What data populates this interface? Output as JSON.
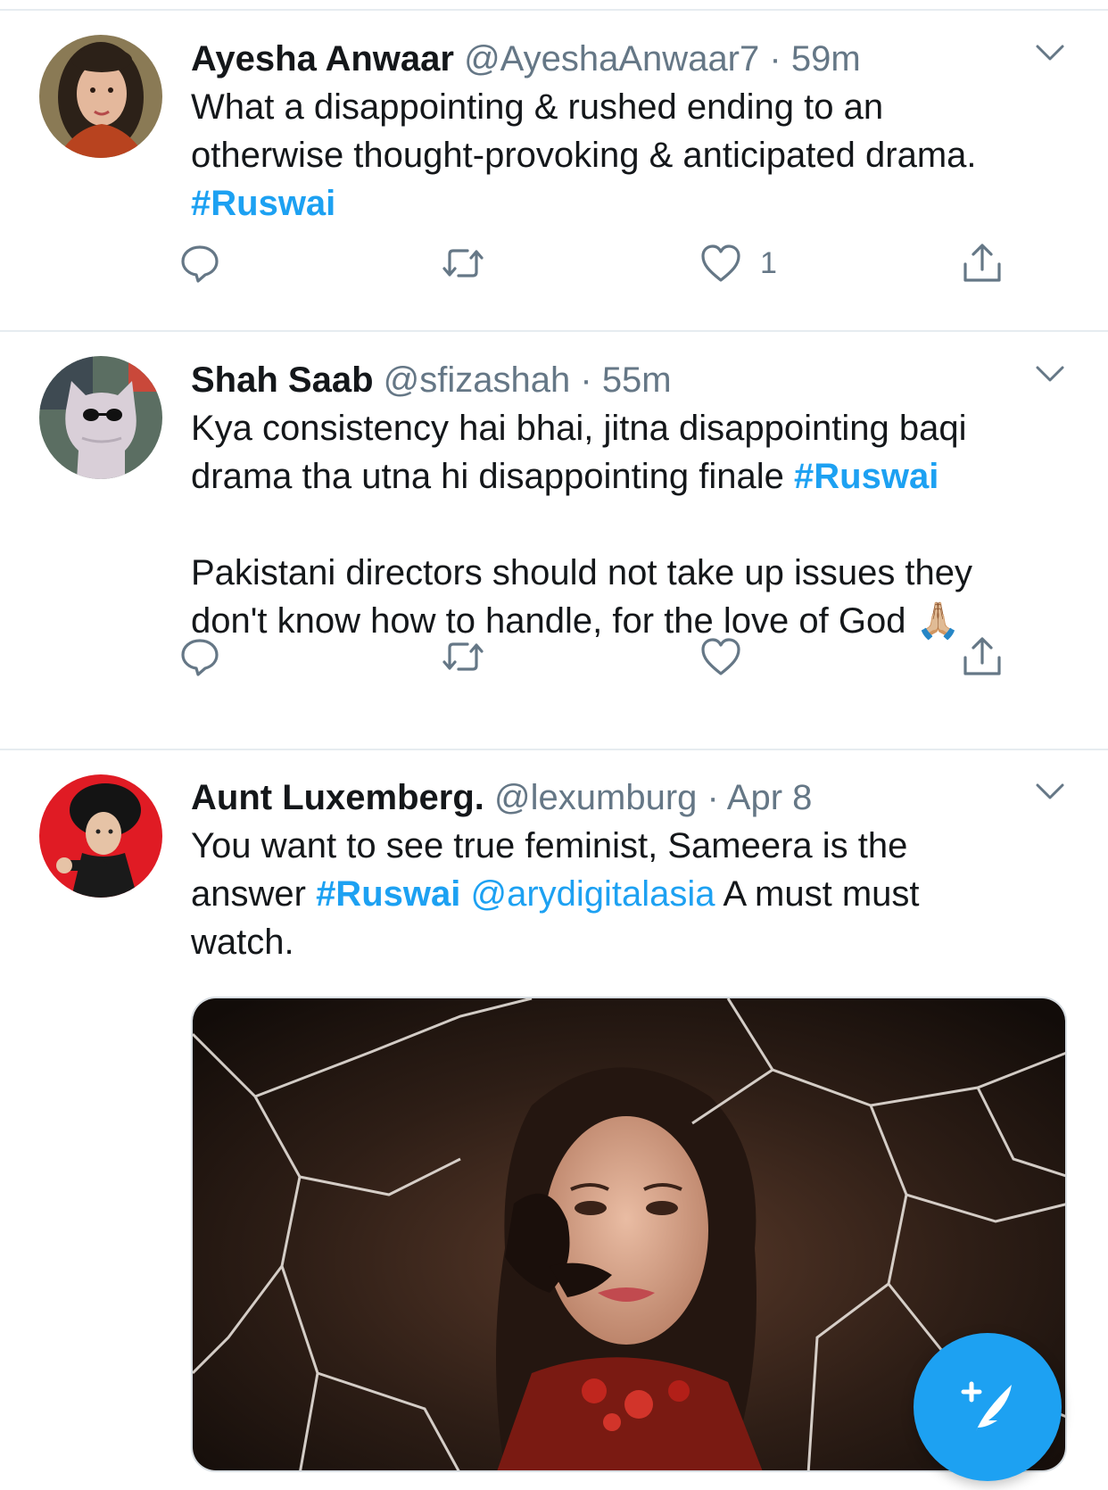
{
  "tweets": [
    {
      "name": "Ayesha Anwaar",
      "handle": "@AyeshaAnwaar7",
      "sep": "·",
      "time": "59m",
      "text": {
        "line1": "What a disappointing & rushed ending to an",
        "line2": "otherwise thought-provoking & anticipated drama.",
        "hashtag": "#Ruswai"
      },
      "like_count": "1"
    },
    {
      "name": "Shah Saab",
      "handle": "@sfizashah",
      "sep": "·",
      "time": "55m",
      "text": {
        "line1": "Kya consistency hai bhai, jitna disappointing baqi",
        "line2": "drama tha utna hi disappointing finale ",
        "hashtag": "#Ruswai",
        "line3": "Pakistani directors should not take up issues they",
        "line4": "don't know how to handle, for the love of God",
        "emoji": "🙏🏼"
      }
    },
    {
      "name": "Aunt Luxemberg.",
      "handle": "@lexumburg",
      "sep": "·",
      "time": "Apr 8",
      "text": {
        "line1": "You want to see true feminist, Sameera is the",
        "line2_prefix": "answer ",
        "hashtag": "#Ruswai",
        "mention": "@arydigitalasia",
        "line2_suffix": " A must must",
        "line3": "watch."
      },
      "media": "cracked-glass-drama-poster"
    }
  ],
  "icons": {
    "reply": "reply-icon",
    "retweet": "retweet-icon",
    "like": "like-icon",
    "share": "share-icon",
    "more": "chevron-down-icon",
    "compose": "compose-tweet-icon"
  },
  "colors": {
    "accent": "#1da1f2",
    "text": "#14171a",
    "muted": "#657786",
    "divider": "#e6ecf0"
  }
}
